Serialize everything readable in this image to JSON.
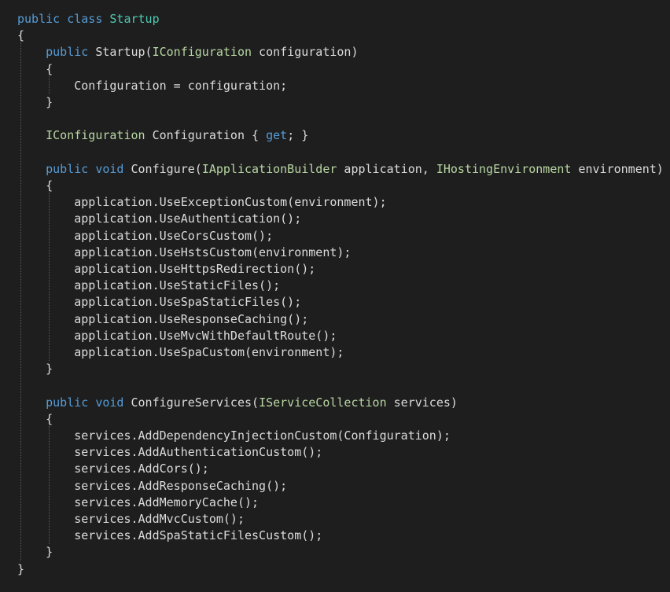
{
  "editor": {
    "theme": {
      "background": "#1e1e1e",
      "keyword": "#569cd6",
      "type": "#4ec9b0",
      "interface": "#b8d7a3",
      "text": "#dcdcdc"
    },
    "lines": [
      [
        {
          "t": "public",
          "c": "kw"
        },
        {
          "t": " ",
          "c": "id"
        },
        {
          "t": "class",
          "c": "kw"
        },
        {
          "t": " ",
          "c": "id"
        },
        {
          "t": "Startup",
          "c": "type"
        }
      ],
      [
        {
          "t": "{",
          "c": "punct"
        }
      ],
      [
        {
          "t": "    ",
          "c": "id"
        },
        {
          "t": "public",
          "c": "kw"
        },
        {
          "t": " Startup(",
          "c": "id"
        },
        {
          "t": "IConfiguration",
          "c": "iface"
        },
        {
          "t": " configuration)",
          "c": "id"
        }
      ],
      [
        {
          "t": "    {",
          "c": "punct"
        }
      ],
      [
        {
          "t": "        Configuration = configuration;",
          "c": "id"
        }
      ],
      [
        {
          "t": "    }",
          "c": "punct"
        }
      ],
      [],
      [
        {
          "t": "    ",
          "c": "id"
        },
        {
          "t": "IConfiguration",
          "c": "iface"
        },
        {
          "t": " Configuration { ",
          "c": "id"
        },
        {
          "t": "get",
          "c": "kw"
        },
        {
          "t": "; }",
          "c": "id"
        }
      ],
      [],
      [
        {
          "t": "    ",
          "c": "id"
        },
        {
          "t": "public",
          "c": "kw"
        },
        {
          "t": " ",
          "c": "id"
        },
        {
          "t": "void",
          "c": "kw"
        },
        {
          "t": " Configure(",
          "c": "id"
        },
        {
          "t": "IApplicationBuilder",
          "c": "iface"
        },
        {
          "t": " application, ",
          "c": "id"
        },
        {
          "t": "IHostingEnvironment",
          "c": "iface"
        },
        {
          "t": " environment)",
          "c": "id"
        }
      ],
      [
        {
          "t": "    {",
          "c": "punct"
        }
      ],
      [
        {
          "t": "        application.UseExceptionCustom(environment);",
          "c": "id"
        }
      ],
      [
        {
          "t": "        application.UseAuthentication();",
          "c": "id"
        }
      ],
      [
        {
          "t": "        application.UseCorsCustom();",
          "c": "id"
        }
      ],
      [
        {
          "t": "        application.UseHstsCustom(environment);",
          "c": "id"
        }
      ],
      [
        {
          "t": "        application.UseHttpsRedirection();",
          "c": "id"
        }
      ],
      [
        {
          "t": "        application.UseStaticFiles();",
          "c": "id"
        }
      ],
      [
        {
          "t": "        application.UseSpaStaticFiles();",
          "c": "id"
        }
      ],
      [
        {
          "t": "        application.UseResponseCaching();",
          "c": "id"
        }
      ],
      [
        {
          "t": "        application.UseMvcWithDefaultRoute();",
          "c": "id"
        }
      ],
      [
        {
          "t": "        application.UseSpaCustom(environment);",
          "c": "id"
        }
      ],
      [
        {
          "t": "    }",
          "c": "punct"
        }
      ],
      [],
      [
        {
          "t": "    ",
          "c": "id"
        },
        {
          "t": "public",
          "c": "kw"
        },
        {
          "t": " ",
          "c": "id"
        },
        {
          "t": "void",
          "c": "kw"
        },
        {
          "t": " ConfigureServices(",
          "c": "id"
        },
        {
          "t": "IServiceCollection",
          "c": "iface"
        },
        {
          "t": " services)",
          "c": "id"
        }
      ],
      [
        {
          "t": "    {",
          "c": "punct"
        }
      ],
      [
        {
          "t": "        services.AddDependencyInjectionCustom(Configuration);",
          "c": "id"
        }
      ],
      [
        {
          "t": "        services.AddAuthenticationCustom();",
          "c": "id"
        }
      ],
      [
        {
          "t": "        services.AddCors();",
          "c": "id"
        }
      ],
      [
        {
          "t": "        services.AddResponseCaching();",
          "c": "id"
        }
      ],
      [
        {
          "t": "        services.AddMemoryCache();",
          "c": "id"
        }
      ],
      [
        {
          "t": "        services.AddMvcCustom();",
          "c": "id"
        }
      ],
      [
        {
          "t": "        services.AddSpaStaticFilesCustom();",
          "c": "id"
        }
      ],
      [
        {
          "t": "    }",
          "c": "punct"
        }
      ],
      [
        {
          "t": "}",
          "c": "punct"
        }
      ]
    ]
  }
}
